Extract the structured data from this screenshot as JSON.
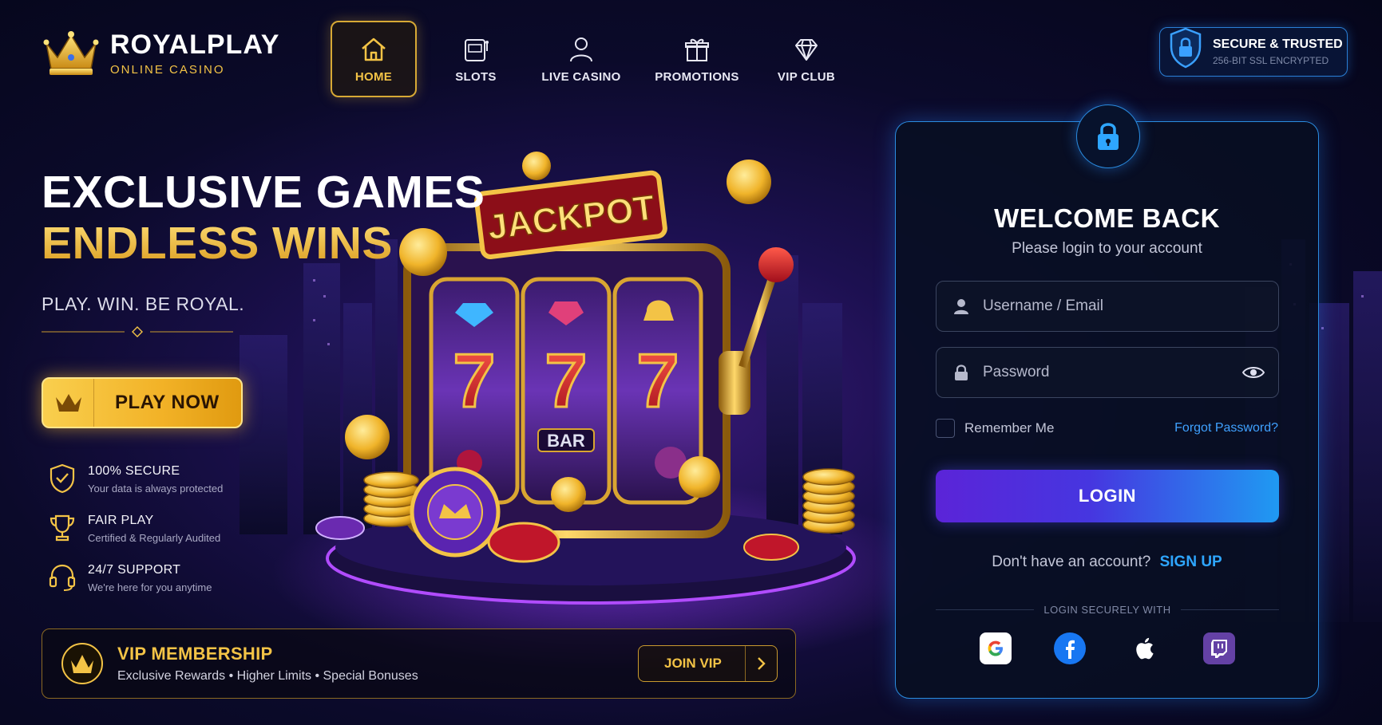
{
  "brand": {
    "name": "ROYALPLAY",
    "tagline": "ONLINE CASINO"
  },
  "nav": {
    "items": [
      {
        "label": "HOME",
        "icon": "home-icon",
        "active": true
      },
      {
        "label": "SLOTS",
        "icon": "slot-machine-icon"
      },
      {
        "label": "LIVE CASINO",
        "icon": "dealer-icon"
      },
      {
        "label": "PROMOTIONS",
        "icon": "gift-icon"
      },
      {
        "label": "VIP CLUB",
        "icon": "diamond-icon"
      }
    ]
  },
  "security_badge": {
    "title": "SECURE & TRUSTED",
    "subtitle": "256-BIT SSL ENCRYPTED",
    "icon": "shield-lock-icon"
  },
  "hero": {
    "title_line1": "EXCLUSIVE GAMES",
    "title_line2": "ENDLESS WINS",
    "tagline": "PLAY. WIN. BE ROYAL.",
    "cta_label": "PLAY NOW"
  },
  "features": [
    {
      "title": "100% SECURE",
      "subtitle": "Your data is always protected",
      "icon": "shield-check-icon"
    },
    {
      "title": "FAIR PLAY",
      "subtitle": "Certified & Regularly Audited",
      "icon": "trophy-icon"
    },
    {
      "title": "24/7 SUPPORT",
      "subtitle": "We're here for you anytime",
      "icon": "headset-icon"
    }
  ],
  "vip": {
    "title": "VIP MEMBERSHIP",
    "subtitle": "Exclusive Rewards • Higher Limits • Special Bonuses",
    "button_label": "JOIN VIP"
  },
  "artwork": {
    "jackpot_sign": "JACKPOT",
    "reel_symbol": "BAR"
  },
  "login": {
    "title": "WELCOME BACK",
    "subtitle": "Please login to your account",
    "username_placeholder": "Username / Email",
    "password_placeholder": "Password",
    "remember_label": "Remember Me",
    "remember_checked": false,
    "forgot_label": "Forgot Password?",
    "submit_label": "LOGIN",
    "signup_prompt": "Don't have an account?",
    "signup_link": "SIGN UP",
    "social_divider": "LOGIN SECURELY WITH",
    "social_providers": [
      "google-icon",
      "facebook-icon",
      "apple-icon",
      "twitch-icon"
    ]
  },
  "colors": {
    "gold": "#f3c346",
    "accent_blue": "#2a8ce0",
    "login_gradient_start": "#5b24d8",
    "login_gradient_end": "#1f9af2",
    "background": "#0b0a2a"
  }
}
